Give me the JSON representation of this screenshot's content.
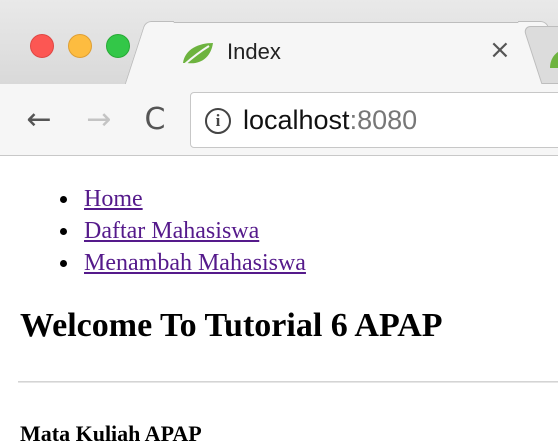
{
  "browser": {
    "tab": {
      "title": "Index",
      "close_glyph": "×",
      "favicon": "spring-leaf-icon"
    },
    "toolbar": {
      "back_glyph": "←",
      "forward_glyph": "→",
      "reload_glyph": "C",
      "info_glyph": "i",
      "url_host": "localhost",
      "url_port": ":8080"
    },
    "colors": {
      "close": "#fc5753",
      "minimize": "#fdbc40",
      "zoom": "#33c748",
      "link": "#551a8b"
    }
  },
  "page": {
    "nav": [
      {
        "label": "Home"
      },
      {
        "label": "Daftar Mahasiswa"
      },
      {
        "label": "Menambah Mahasiswa"
      }
    ],
    "heading": "Welcome To Tutorial 6 APAP",
    "subheading": "Mata Kuliah APAP"
  }
}
